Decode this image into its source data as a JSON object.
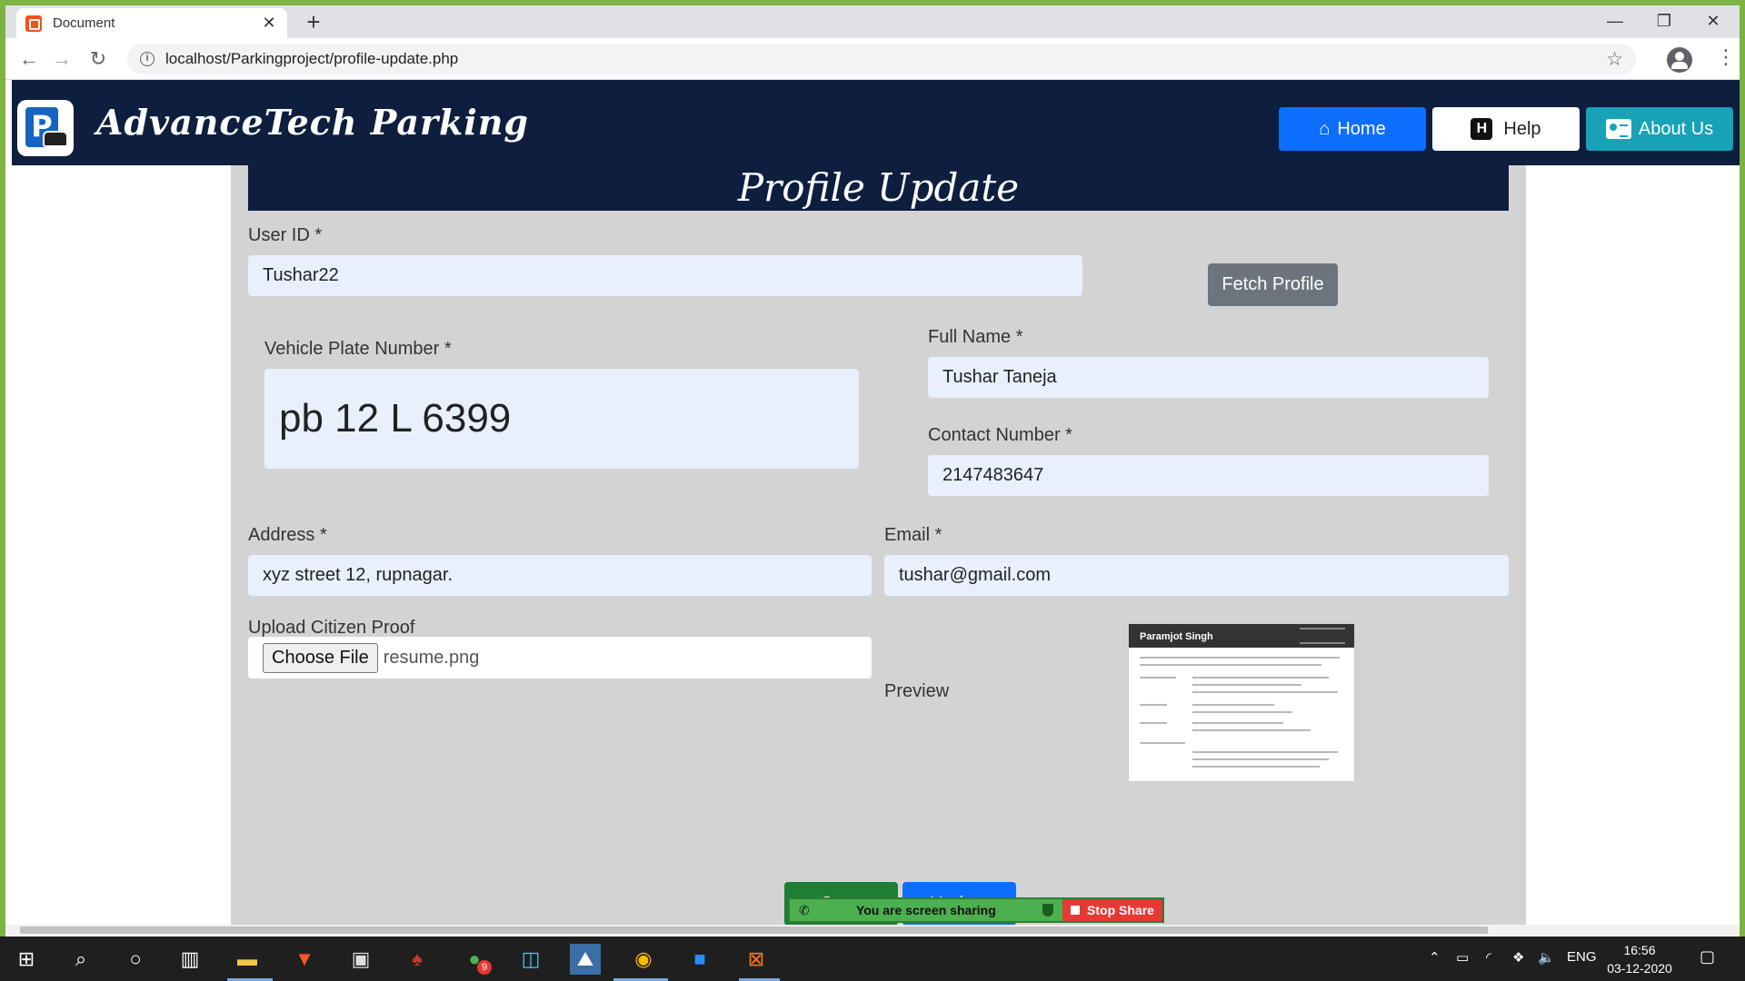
{
  "browser": {
    "tab_title": "Document",
    "tab_close": "✕",
    "new_tab": "+",
    "url": "localhost/Parkingproject/profile-update.php",
    "window_controls": [
      "—",
      "❐",
      "✕"
    ]
  },
  "header": {
    "brand": "AdvanceTech Parking",
    "nav": {
      "home": "Home",
      "help": "Help",
      "about": "About Us"
    }
  },
  "form": {
    "title": "Profile Update",
    "user_id": {
      "label": "User ID *",
      "value": "Tushar22"
    },
    "fetch_button": "Fetch Profile",
    "vehicle_plate": {
      "label": "Vehicle Plate Number *",
      "value": "pb 12 L 6399"
    },
    "full_name": {
      "label": "Full Name *",
      "value": "Tushar Taneja"
    },
    "contact": {
      "label": "Contact Number *",
      "value": "2147483647"
    },
    "address": {
      "label": "Address *",
      "value": "xyz street 12, rupnagar."
    },
    "email": {
      "label": "Email *",
      "value": "tushar@gmail.com"
    },
    "citizen_proof": {
      "label": "Upload Citizen Proof",
      "button": "Choose File",
      "file_name": "resume.png"
    },
    "preview": {
      "label": "Preview",
      "doc_name": "Paramjot Singh"
    },
    "save_button": "Save",
    "update_button": "Update"
  },
  "screen_share": {
    "message": "You are screen sharing",
    "stop": "Stop Share"
  },
  "taskbar": {
    "language": "ENG",
    "time": "16:56",
    "date": "03-12-2020",
    "chrome_badge": "9"
  },
  "colors": {
    "navy": "#0e1e3e",
    "primary_blue": "#0d6efd",
    "teal": "#17a2b8",
    "gray_button": "#6c757d",
    "green_button": "#1e7e34",
    "panel_bg": "#d3d3d3",
    "input_bg": "#e8f0fe"
  }
}
